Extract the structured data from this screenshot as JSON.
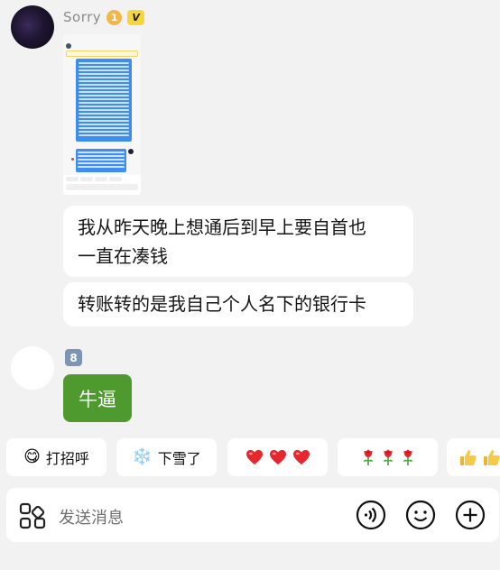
{
  "sender": {
    "name": "Sorry",
    "level_badge": "1",
    "verified_badge": "V"
  },
  "messages": [
    {
      "id": "m1",
      "text_line1": "我从昨天晚上想通后到早上要自首也",
      "text_line2": "一直在凑钱"
    },
    {
      "id": "m2",
      "text": "转账转的是我自己个人名下的银行卡"
    }
  ],
  "reply": {
    "number_badge": "8",
    "text": "牛逼"
  },
  "quick_replies": [
    {
      "icon": "smiling-face-icon",
      "emoji": "😋",
      "label": "打招呼"
    },
    {
      "icon": "snowflake-icon",
      "emoji": "❄️",
      "label": "下雪了"
    },
    {
      "icon": "hearts-icon",
      "label": ""
    },
    {
      "icon": "roses-icon",
      "label": ""
    },
    {
      "icon": "thumbs-up-icon",
      "label": ""
    }
  ],
  "composer": {
    "placeholder": "发送消息"
  },
  "colors": {
    "background": "#f2f2f2",
    "bubble": "#ffffff",
    "reply_bubble": "#4f9a2f",
    "level_badge": "#f2b64a",
    "verified_badge": "#f6d63c",
    "number_badge": "#7d95b5"
  }
}
